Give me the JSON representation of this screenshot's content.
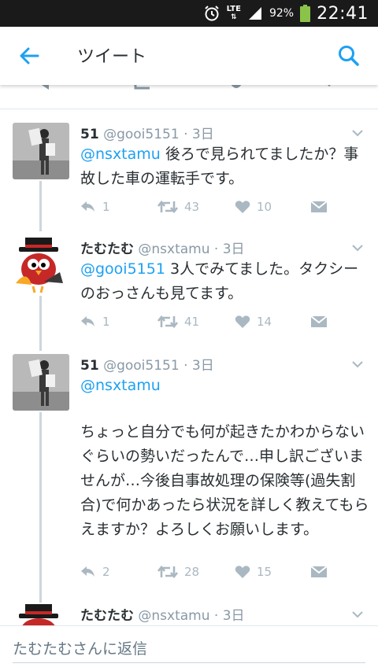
{
  "status_bar": {
    "network": "LTE",
    "battery": "92%",
    "time": "22:41"
  },
  "app_bar": {
    "title": "ツイート"
  },
  "tweets": [
    {
      "name": "51",
      "handle": "@gooi5151",
      "time": "3日",
      "mention": "@nsxtamu",
      "text": " 後ろで見られてましたか？事故した車の運転手です。",
      "replies": "1",
      "retweets": "43",
      "likes": "10"
    },
    {
      "name": "たむたむ",
      "handle": "@nsxtamu",
      "time": "3日",
      "mention": "@gooi5151",
      "text": " 3人でみてました。タクシーのおっさんも見てます。",
      "replies": "1",
      "retweets": "41",
      "likes": "14"
    },
    {
      "name": "51",
      "handle": "@gooi5151",
      "time": "3日",
      "mention": "@nsxtamu",
      "text": "ちょっと自分でも何が起きたかわからないぐらいの勢いだったんで…申し訳ございませんが…今後自事故処理の保険等(過失割合)で何かあったら状況を詳しく教えてもらえますか？よろしくお願いします。",
      "replies": "2",
      "retweets": "28",
      "likes": "15"
    },
    {
      "name": "たむたむ",
      "handle": "@nsxtamu",
      "time": "3日"
    }
  ],
  "reply_bar": {
    "placeholder": "たむたむさんに返信"
  },
  "colors": {
    "accent": "#1da1f2",
    "muted": "#8899a6",
    "icon": "#aab8c2"
  }
}
